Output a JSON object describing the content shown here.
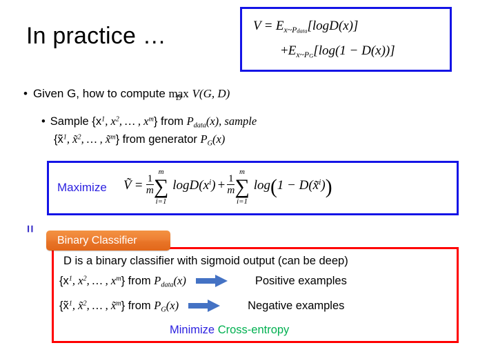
{
  "slide": {
    "title": "In practice …"
  },
  "top_formula_box": {
    "border_color": "#1414E6",
    "line1": {
      "V": "V",
      "eq": "=",
      "E": "E",
      "sub": "x~P",
      "sub2": "data",
      "body": "[logD(x)]"
    },
    "line2": {
      "plus": "+",
      "E": "E",
      "sub": "x~P",
      "sub2": "G",
      "body": "[log(1 − D(x))]"
    },
    "plain_text": "V = E_{x~P_data}[logD(x)] + E_{x~P_G}[log(1 - D(x))]"
  },
  "bullets": {
    "bullet1": {
      "marker": "•",
      "text_before": "Given G, how to compute",
      "operator": "max",
      "operator_sub": "D",
      "operand": "V(G, D)",
      "plain_text": "Given G, how to compute max_D V(G,D)"
    },
    "bullet2": {
      "marker": "•",
      "line1_a": "Sample {x",
      "line1_sup1": "1",
      "line1_b": ", x",
      "line1_sup2": "2",
      "line1_c": ", … , x",
      "line1_sup3": "m",
      "line1_d": "} from ",
      "line1_P": "P",
      "line1_Psub": "data",
      "line1_e": "(x), sample",
      "line2_a": "{x̃",
      "line2_sup1": "1",
      "line2_b": ", x̃",
      "line2_sup2": "2",
      "line2_c": ", … , x̃",
      "line2_sup3": "m",
      "line2_d": "} from generator ",
      "line2_P": "P",
      "line2_Psub": "G",
      "line2_e": "(x)",
      "plain_text": "Sample {x^1, x^2, ..., x^m} from P_data(x), sample {x~^1, x~^2, ..., x~^m} from generator P_G(x)"
    }
  },
  "equals_mark": {
    "symbol": "=",
    "color": "#3B31C8"
  },
  "maximize_box": {
    "border_color": "#1414E6",
    "label": "Maximize",
    "label_color": "#2A1FE0",
    "formula": {
      "Vtilde": "Ṽ",
      "eq": "=",
      "frac1_num": "1",
      "frac1_den": "m",
      "sum1_top": "m",
      "sum1_sym": "∑",
      "sum1_bot": "i=1",
      "term1": "logD(x",
      "term1_sup": "i",
      "term1_end": ")",
      "plus": "+",
      "frac2_num": "1",
      "frac2_den": "m",
      "sum2_top": "m",
      "sum2_sym": "∑",
      "sum2_bot": "i=1",
      "term2": "log",
      "term2_body": "1 − D(x̃",
      "term2_sup": "i",
      "term2_end": ")"
    },
    "plain_text": "Maximize  V~ = (1/m) sum_{i=1}^{m} logD(x^i) + (1/m) sum_{i=1}^{m} log(1 - D(x~^i))"
  },
  "binary_classifier_badge": {
    "label": "Binary Classifier",
    "background_start": "#F39242",
    "background_end": "#E2681A",
    "text_color": "#FFFFFF"
  },
  "classifier_box": {
    "border_color": "#FF0000",
    "line1": "D is a binary classifier with sigmoid output (can be deep)",
    "line2": {
      "set_a": "{x",
      "sup1": "1",
      "set_b": ", x",
      "sup2": "2",
      "set_c": ", … , x",
      "sup3": "m",
      "set_d": "} from ",
      "P": "P",
      "Psub": "data",
      "paren": "(x)",
      "arrow": "right-arrow-icon",
      "result": "Positive examples"
    },
    "line3": {
      "set_a": "{x̃",
      "sup1": "1",
      "set_b": ", x̃",
      "sup2": "2",
      "set_c": ", … , x̃",
      "sup3": "m",
      "set_d": "} from ",
      "P": "P",
      "Psub": "G",
      "paren": "(x)",
      "arrow": "right-arrow-icon",
      "result": "Negative examples"
    },
    "line4": {
      "minimize": "Minimize",
      "minimize_color": "#2A1FE0",
      "objective": "Cross-entropy",
      "objective_color": "#00B050"
    },
    "arrow_color": "#4472C4"
  }
}
